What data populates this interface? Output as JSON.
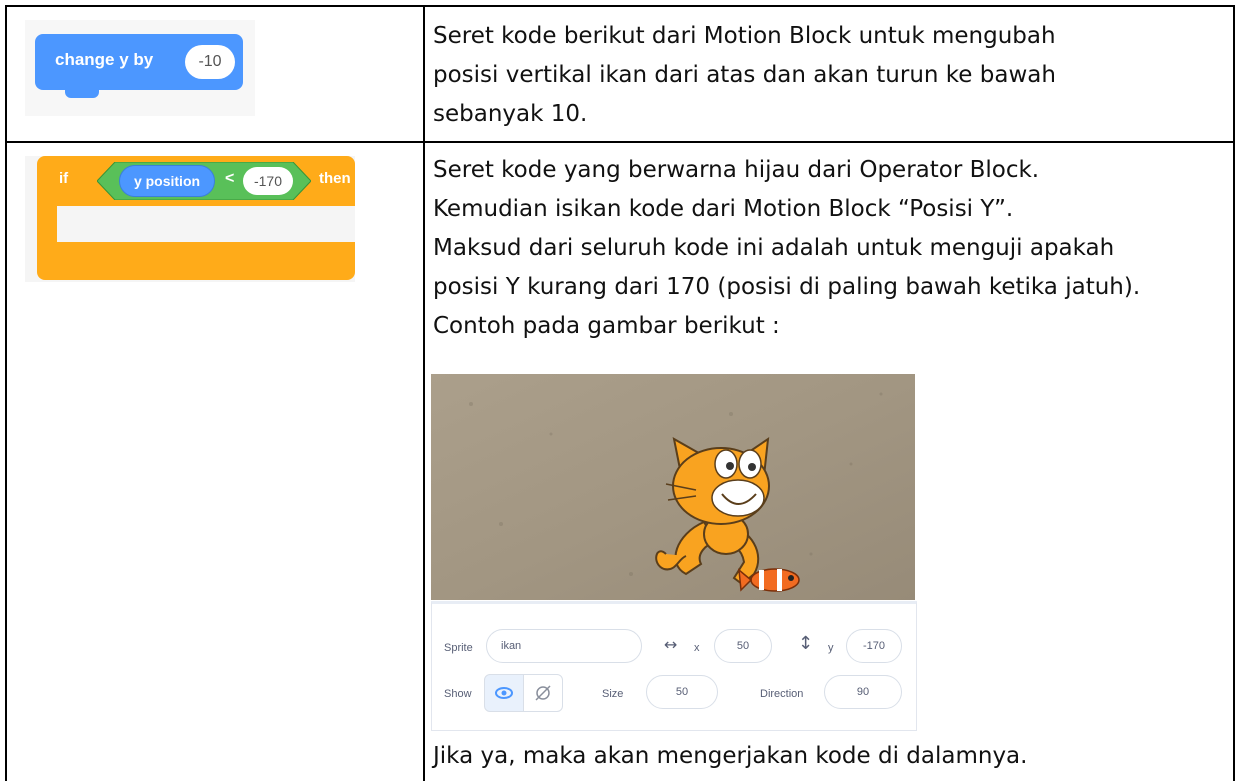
{
  "row1": {
    "block": {
      "label": "change y by",
      "value": "-10"
    },
    "text": [
      "Seret kode berikut dari Motion Block untuk mengubah",
      "posisi vertikal ikan dari atas dan akan turun ke bawah",
      "sebanyak 10."
    ]
  },
  "row2": {
    "block": {
      "if_label": "if",
      "reporter": "y position",
      "operator": "<",
      "value": "-170",
      "then_label": "then"
    },
    "text": [
      "Seret kode yang berwarna hijau dari Operator Block.",
      "Kemudian isikan kode dari Motion Block “Posisi Y”.",
      "Maksud dari seluruh kode ini adalah untuk menguji apakah",
      "posisi Y kurang dari 170 (posisi di paling bawah ketika jatuh).",
      "Contoh pada gambar berikut :"
    ],
    "footer": "Jika ya, maka akan mengerjakan kode di dalamnya.",
    "sprite_panel": {
      "sprite_label": "Sprite",
      "sprite_name": "ikan",
      "x_label": "x",
      "x_value": "50",
      "y_label": "y",
      "y_value": "-170",
      "show_label": "Show",
      "size_label": "Size",
      "size_value": "50",
      "direction_label": "Direction",
      "direction_value": "90"
    }
  },
  "colors": {
    "motion": "#4c97ff",
    "control": "#ffab19",
    "operator": "#59c059",
    "stage_sand": "#a39784"
  }
}
